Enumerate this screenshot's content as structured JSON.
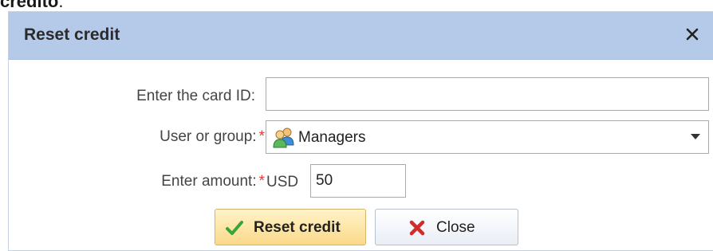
{
  "page": {
    "heading_fragment": "credito",
    "heading_period": "."
  },
  "dialog": {
    "title": "Reset credit",
    "close_glyph": "×"
  },
  "form": {
    "card_id": {
      "label": "Enter the card ID:",
      "value": "",
      "required": false
    },
    "user_group": {
      "label": "User or group:",
      "required_mark": "*",
      "selected": "Managers",
      "icon": "user-group-icon"
    },
    "amount": {
      "label": "Enter amount:",
      "required_mark": "*",
      "currency": "USD",
      "value": "50"
    }
  },
  "buttons": {
    "reset": {
      "label": "Reset credit",
      "icon": "checkmark-icon"
    },
    "close": {
      "label": "Close",
      "icon": "x-icon"
    }
  },
  "colors": {
    "titlebar": "#b5c9e8",
    "required": "#e23a3a",
    "primary_button": "#fbd98a",
    "check_green": "#3aa43a",
    "x_red": "#d12c2c"
  }
}
